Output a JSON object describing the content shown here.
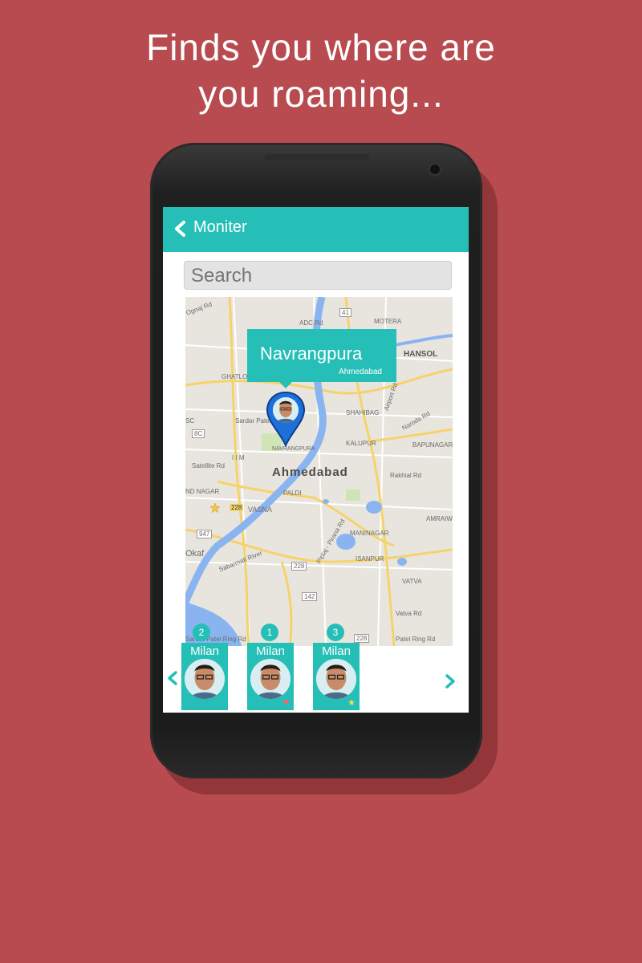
{
  "headline": {
    "line1": "Finds you where are",
    "line2": "you roaming..."
  },
  "appbar": {
    "title": "Moniter",
    "back_icon": "chevron-left-icon"
  },
  "search": {
    "placeholder": "Search"
  },
  "map": {
    "city_label": "Ahmedabad",
    "callout_title": "Navrangpura",
    "callout_subtitle": "Ahmedabad",
    "labels": {
      "motera": "MOTERA",
      "hansol": "HANSOL",
      "ghatlodia": "GHATLOD",
      "shahibag": "SHAHIBAG",
      "sardar": "Sardar Patel Stadium,",
      "navrangpura_small": "NAVRANGPURA",
      "kalupur": "KALUPUR",
      "bapunagar": "BAPUNAGAR",
      "paldi": "PALDI",
      "vasna": "VASNA",
      "maninagar": "MANINAGAR",
      "isanpur": "ISANPUR",
      "amraiwadi": "AMRAIW",
      "vatva": "VATVA",
      "satellite": "Satellite Rd",
      "okaf": "Okaf",
      "sabarmati": "Sabarmati River",
      "sardar_ring": "Sardar Patel Ring Rd",
      "patel_ring": "Patel Ring Rd",
      "road41": "41",
      "road228a": "228",
      "road228b": "228",
      "road228c": "228",
      "road142": "142",
      "road947": "947",
      "road8c": "8C",
      "adc": "ADC Rd",
      "ognaj": "Ognaj Rd",
      "airport": "Airport Rd",
      "rakhial": "Rakhial Rd",
      "naroda": "Naroda Rd",
      "vatva_rd": "Vatva Rd",
      "pirana": "Piplaj - Pirana Rd",
      "nadnagar": "ND NAGAR",
      "iim": "I I M",
      "sc": "SC"
    }
  },
  "contacts": [
    {
      "badge": "2",
      "name": "Milan",
      "mark": ""
    },
    {
      "badge": "1",
      "name": "Milan",
      "mark": "❤"
    },
    {
      "badge": "3",
      "name": "Milan",
      "mark": "★"
    }
  ],
  "colors": {
    "background": "#b84b4f",
    "accent": "#26bfb7"
  }
}
